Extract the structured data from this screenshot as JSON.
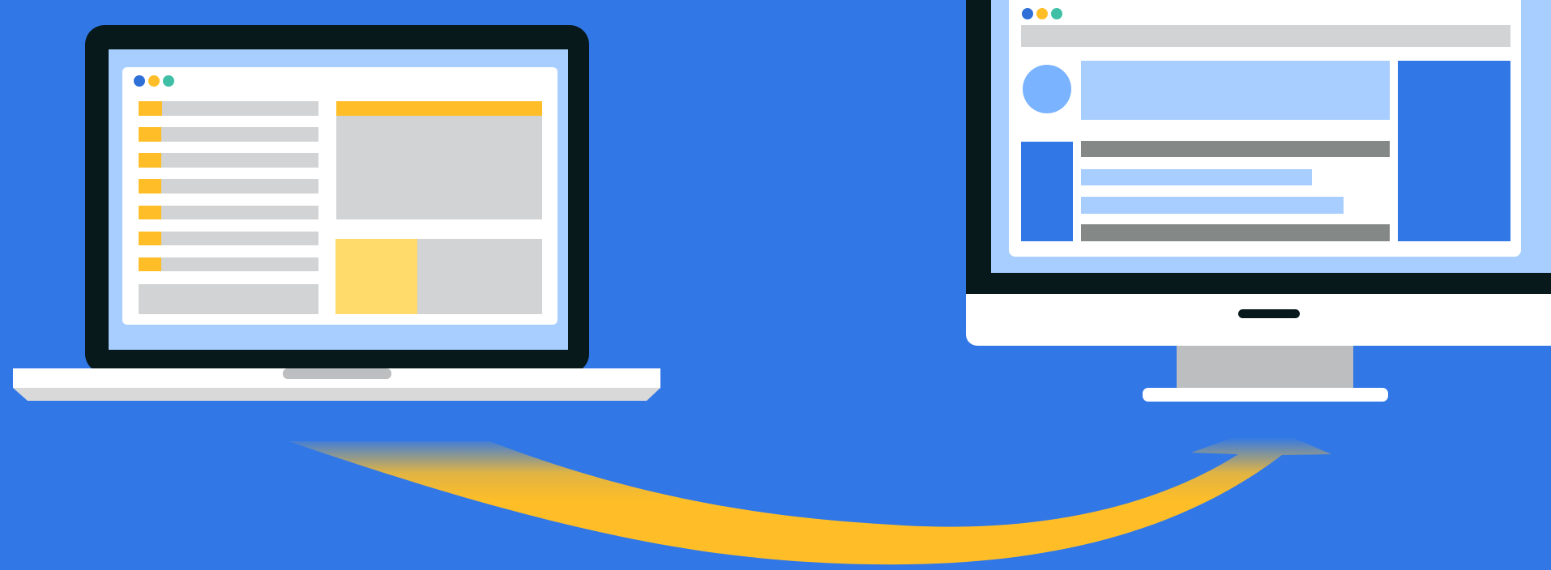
{
  "colors": {
    "background": "#3178E6",
    "device_frame": "#07191B",
    "screen_light_blue": "#A8CEFF",
    "panel_white": "#FFFFFF",
    "placeholder_gray": "#D2D3D4",
    "placeholder_dark_gray": "#848887",
    "accent_yellow": "#FFBE27",
    "accent_pale_yellow": "#FFDB6B",
    "accent_blue": "#3178E6",
    "avatar_blue": "#7AB3FF",
    "dot_blue": "#2F6FD8",
    "dot_yellow": "#FFBE27",
    "dot_teal": "#3FBFA6",
    "stand_gray": "#BDBEC0",
    "laptop_base_shadow": "#D9D9DA"
  },
  "icons": {
    "laptop": "laptop-icon",
    "desktop": "desktop-monitor-icon",
    "arrow": "transfer-arrow-icon"
  }
}
